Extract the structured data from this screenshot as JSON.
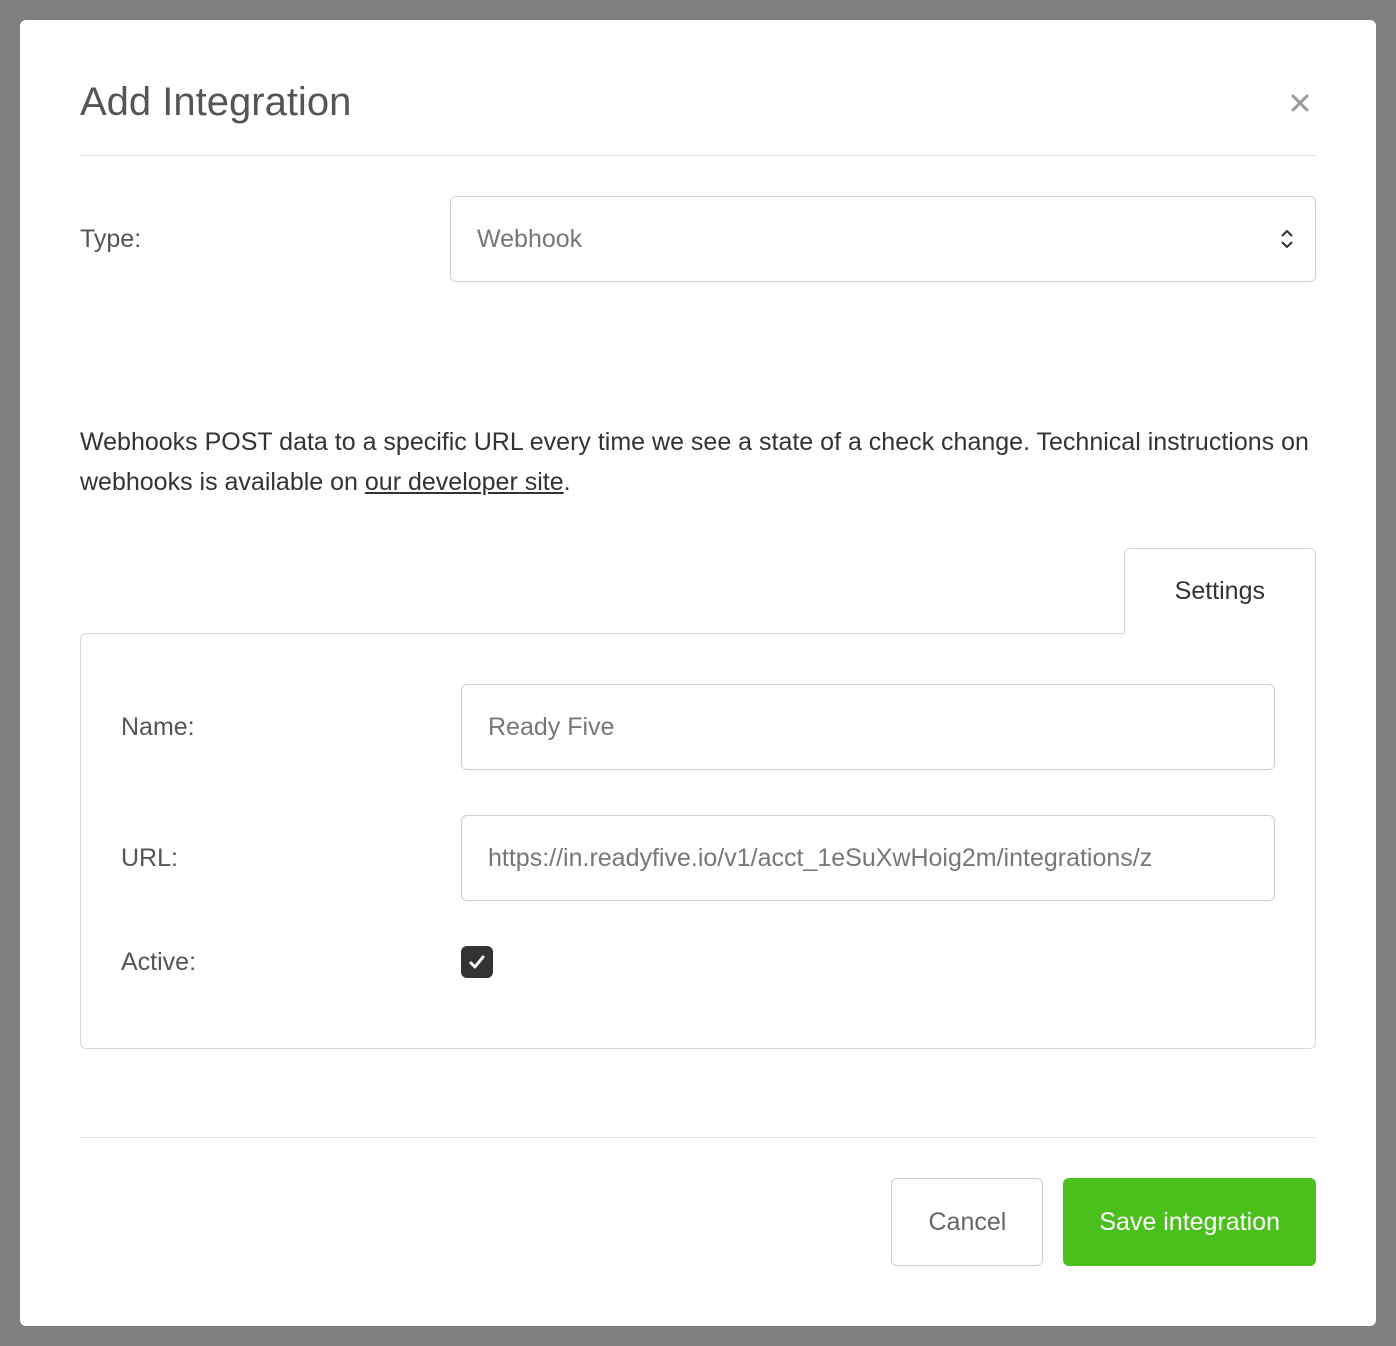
{
  "modal": {
    "title": "Add Integration",
    "type_label": "Type:",
    "type_value": "Webhook",
    "description_text_1": "Webhooks POST data to a specific URL every time we see a state of a check change. Technical instructions on webhooks is available on ",
    "description_link": "our developer site",
    "description_text_2": ".",
    "tab_settings": "Settings",
    "name_label": "Name:",
    "name_value": "Ready Five",
    "url_label": "URL:",
    "url_value": "https://in.readyfive.io/v1/acct_1eSuXwHoig2m/integrations/z",
    "active_label": "Active:",
    "active_checked": true,
    "cancel_label": "Cancel",
    "save_label": "Save integration"
  }
}
